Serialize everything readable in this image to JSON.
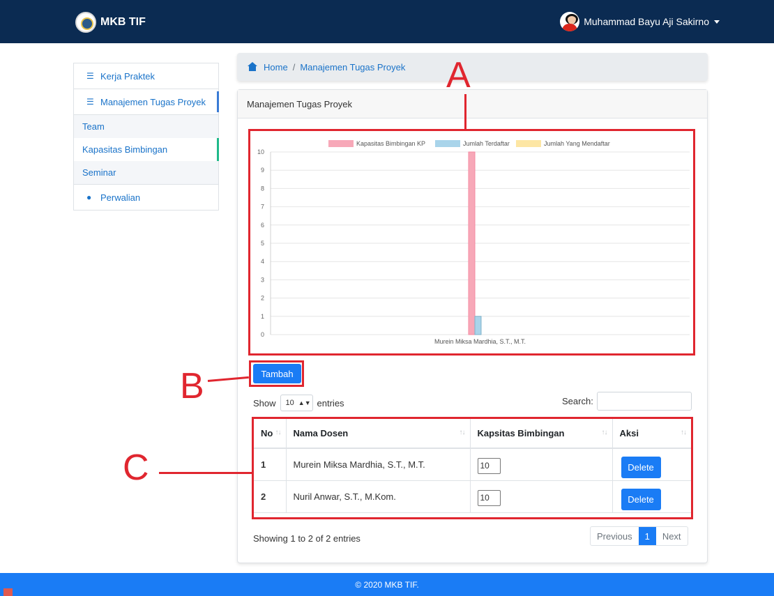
{
  "navbar": {
    "brand": "MKB TIF",
    "user_name": "Muhammad Bayu Aji Sakirno"
  },
  "sidebar": {
    "items": [
      {
        "label": "Kerja Praktek",
        "icon": "list-icon"
      },
      {
        "label": "Manajemen Tugas Proyek",
        "icon": "list-icon"
      }
    ],
    "sub_items": [
      {
        "label": "Team"
      },
      {
        "label": "Kapasitas Bimbingan"
      },
      {
        "label": "Seminar"
      }
    ],
    "last_item": {
      "label": "Perwalian",
      "icon": "users-icon"
    }
  },
  "breadcrumb": {
    "home": "Home",
    "separator": "/",
    "current": "Manajemen Tugas Proyek"
  },
  "card": {
    "title": "Manajemen Tugas Proyek"
  },
  "annotations": {
    "chart": "A",
    "button": "B",
    "table": "C",
    "color": "#e0262f"
  },
  "chart_data": {
    "type": "bar",
    "categories": [
      "Murein Miksa Mardhia,  S.T.,  M.T."
    ],
    "series": [
      {
        "name": "Kapasitas Bimbingan KP",
        "values": [
          10
        ],
        "color": "#f7a8b8"
      },
      {
        "name": "Jumlah Terdaftar",
        "values": [
          1
        ],
        "color": "#a9d4ea"
      },
      {
        "name": "Jumlah Yang Mendaftar",
        "values": [
          0
        ],
        "color": "#fde6a4"
      }
    ],
    "ylim": [
      0,
      10
    ],
    "yticks": [
      "0",
      "1",
      "2",
      "3",
      "4",
      "5",
      "6",
      "7",
      "8",
      "9",
      "10"
    ],
    "legend": "top",
    "grid": true
  },
  "toolbar": {
    "add_label": "Tambah"
  },
  "table_controls": {
    "show_label": "Show",
    "entries_value": "10",
    "entries_label": "entries",
    "search_label": "Search:"
  },
  "table": {
    "columns": [
      "No",
      "Nama Dosen",
      "Kapsitas Bimbingan",
      "Aksi"
    ],
    "rows": [
      {
        "no": "1",
        "nama": "Murein Miksa Mardhia, S.T., M.T.",
        "kapasitas": "10",
        "aksi": "Delete"
      },
      {
        "no": "2",
        "nama": "Nuril Anwar, S.T., M.Kom.",
        "kapasitas": "10",
        "aksi": "Delete"
      }
    ]
  },
  "pagination": {
    "info": "Showing 1 to 2 of 2 entries",
    "previous": "Previous",
    "current": "1",
    "next": "Next"
  },
  "footer": {
    "text": "© 2020 MKB TIF."
  },
  "colors": {
    "navbar": "#0b2b52",
    "primary": "#1a7cf5",
    "link": "#1a73c9"
  }
}
